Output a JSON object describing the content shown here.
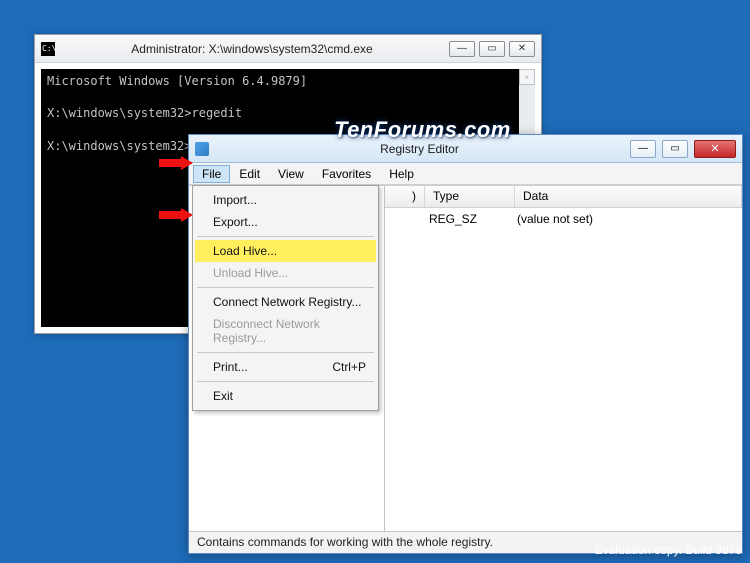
{
  "cmd": {
    "title": "Administrator: X:\\windows\\system32\\cmd.exe",
    "line1": "Microsoft Windows [Version 6.4.9879]",
    "prompt1": "X:\\windows\\system32>",
    "typed1": "regedit",
    "prompt2": "X:\\windows\\system32>"
  },
  "reg": {
    "title": "Registry Editor",
    "menus": {
      "file": "File",
      "edit": "Edit",
      "view": "View",
      "favorites": "Favorites",
      "help": "Help"
    },
    "file_menu": {
      "import": "Import...",
      "export": "Export...",
      "load_hive": "Load Hive...",
      "unload_hive": "Unload Hive...",
      "connect": "Connect Network Registry...",
      "disconnect": "Disconnect Network Registry...",
      "print": "Print...",
      "print_accel": "Ctrl+P",
      "exit": "Exit"
    },
    "columns": {
      "name": "",
      "type": "Type",
      "data": "Data"
    },
    "row": {
      "type": "REG_SZ",
      "data": "(value not set)"
    },
    "status": "Contains commands for working with the whole registry.",
    "partial_paren": ")"
  },
  "watermark": "TenForums.com",
  "eval": "Evaluation copy. Build 9879"
}
